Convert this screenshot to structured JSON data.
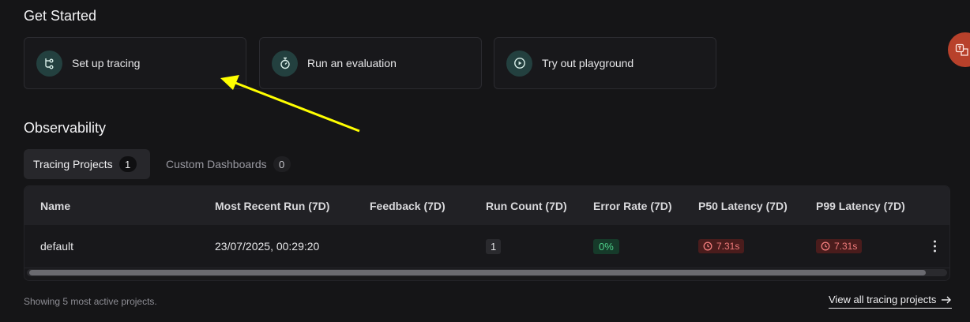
{
  "sections": {
    "get_started": "Get Started",
    "observability": "Observability"
  },
  "cards": [
    {
      "label": "Set up tracing",
      "icon": "tracing-icon"
    },
    {
      "label": "Run an evaluation",
      "icon": "stopwatch-icon"
    },
    {
      "label": "Try out playground",
      "icon": "play-circle-icon"
    }
  ],
  "tabs": [
    {
      "label": "Tracing Projects",
      "count": "1",
      "active": true
    },
    {
      "label": "Custom Dashboards",
      "count": "0",
      "active": false
    }
  ],
  "table": {
    "columns": [
      "Name",
      "Most Recent Run (7D)",
      "Feedback (7D)",
      "Run Count (7D)",
      "Error Rate (7D)",
      "P50 Latency (7D)",
      "P99 Latency (7D)"
    ],
    "rows": [
      {
        "name": "default",
        "most_recent_run": "23/07/2025, 00:29:20",
        "feedback": "",
        "run_count": "1",
        "error_rate": "0%",
        "p50_latency": "7.31s",
        "p99_latency": "7.31s"
      }
    ]
  },
  "footer": {
    "note": "Showing 5 most active projects.",
    "view_all": "View all tracing projects"
  },
  "colors": {
    "background": "#151517",
    "card_icon_bg": "#23403f",
    "success": "#4ed08a",
    "danger": "#f07c7c",
    "annotation_arrow": "#ffff00"
  }
}
